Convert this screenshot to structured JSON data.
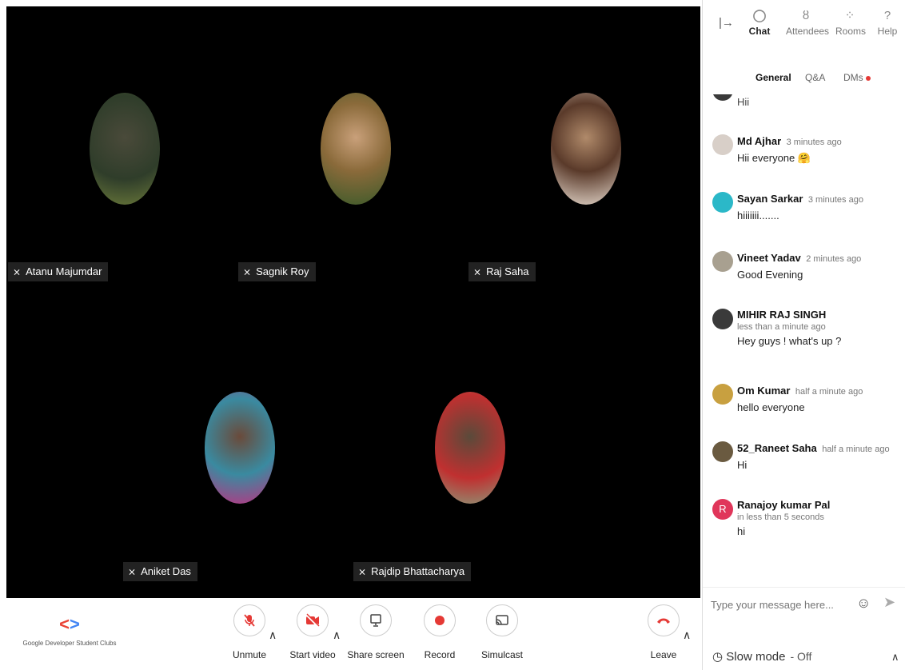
{
  "participants": [
    {
      "name": "Atanu Majumdar",
      "color": "#3d5a3a"
    },
    {
      "name": "Sagnik Roy",
      "color": "#6b5a2a"
    },
    {
      "name": "Raj Saha",
      "color": "#8a6a52"
    },
    {
      "name": "Aniket Das",
      "color": "#8a4070"
    },
    {
      "name": "Rajdip Bhattacharya",
      "color": "#6a6a5a"
    }
  ],
  "bottombar": {
    "logo_text": "Google Developer Student Clubs",
    "unmute": "Unmute",
    "start_video": "Start video",
    "share_screen": "Share screen",
    "record": "Record",
    "simulcast": "Simulcast",
    "leave": "Leave"
  },
  "panel": {
    "tabs": [
      "Chat",
      "Attendees",
      "Rooms",
      "Help"
    ],
    "subtabs": {
      "general": "General",
      "qa": "Q&A",
      "dms": "DMs"
    },
    "partial_message": "Hii",
    "messages": [
      {
        "name": "Md Ajhar",
        "time": "3 minutes ago",
        "text": "Hii everyone 🤗"
      },
      {
        "name": "Sayan Sarkar",
        "time": "3 minutes ago",
        "text": "hiiiiiii......."
      },
      {
        "name": "Vineet Yadav",
        "time": "2 minutes ago",
        "text": "Good Evening"
      },
      {
        "name": "MIHIR RAJ SINGH",
        "time": "less than a minute ago",
        "text": "Hey guys ! what's up ?"
      },
      {
        "name": "Om Kumar",
        "time": "half a minute ago",
        "text": "hello everyone"
      },
      {
        "name": "52_Raneet Saha",
        "time": "half a minute ago",
        "text": "Hi"
      },
      {
        "name": "Ranajoy kumar Pal",
        "time": "in less than 5 seconds",
        "text": "hi",
        "initial": "R"
      }
    ],
    "composer_placeholder": "Type your message here...",
    "slow_mode_label": "Slow mode",
    "slow_mode_value": "- Off"
  }
}
